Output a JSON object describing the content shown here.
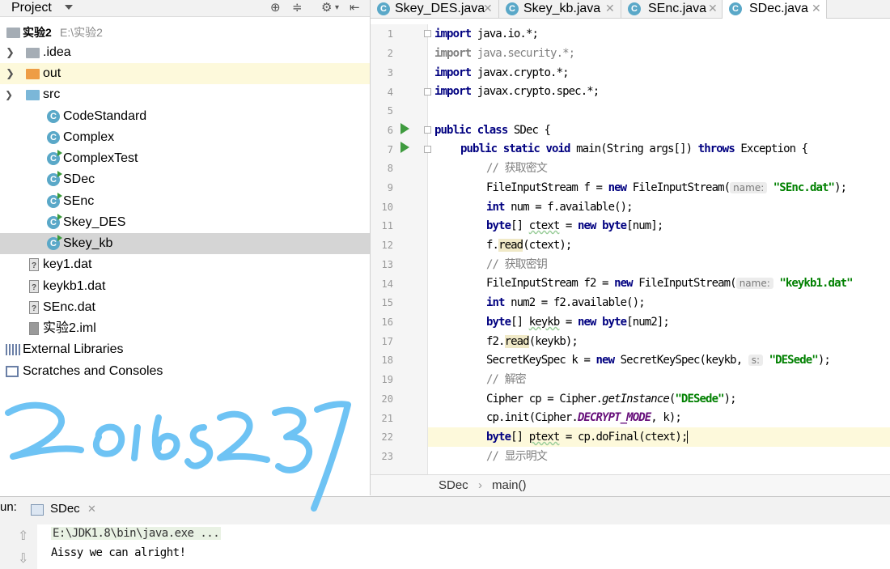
{
  "project_panel": {
    "title": "Project",
    "tree": [
      {
        "label": "实验2",
        "path": "E:\\实验2",
        "type": "module"
      },
      {
        "label": ".idea",
        "type": "folder"
      },
      {
        "label": "out",
        "type": "folder"
      },
      {
        "label": "src",
        "type": "folder"
      },
      {
        "label": "CodeStandard",
        "type": "class"
      },
      {
        "label": "Complex",
        "type": "class"
      },
      {
        "label": "ComplexTest",
        "type": "class"
      },
      {
        "label": "SDec",
        "type": "class"
      },
      {
        "label": "SEnc",
        "type": "class"
      },
      {
        "label": "Skey_DES",
        "type": "class"
      },
      {
        "label": "Skey_kb",
        "type": "class"
      },
      {
        "label": "key1.dat",
        "type": "file"
      },
      {
        "label": "keykb1.dat",
        "type": "file"
      },
      {
        "label": "SEnc.dat",
        "type": "file"
      },
      {
        "label": "实验2.iml",
        "type": "file"
      },
      {
        "label": "External Libraries",
        "type": "library"
      },
      {
        "label": "Scratches and Consoles",
        "type": "scratches"
      }
    ]
  },
  "editor": {
    "tabs": [
      {
        "label": "Skey_DES.java"
      },
      {
        "label": "Skey_kb.java"
      },
      {
        "label": "SEnc.java"
      },
      {
        "label": "SDec.java",
        "active": true
      }
    ],
    "line_numbers": [
      "1",
      "2",
      "3",
      "4",
      "5",
      "6",
      "7",
      "8",
      "9",
      "10",
      "11",
      "12",
      "13",
      "14",
      "15",
      "16",
      "17",
      "18",
      "19",
      "20",
      "21",
      "22",
      "23"
    ],
    "code": {
      "l1_kw": "import",
      "l1_rest": " java.io.*;",
      "l2_kw": "import",
      "l2_rest": " java.security.*;",
      "l3_kw": "import",
      "l3_rest": " javax.crypto.*;",
      "l4_kw": "import",
      "l4_rest": " javax.crypto.spec.*;",
      "l6_kw1": "public",
      "l6_kw2": "class",
      "l6_rest": " SDec {",
      "l7_kw1": "public",
      "l7_kw2": "static",
      "l7_kw3": "void",
      "l7_mid": " main(String args[]) ",
      "l7_kw4": "throws",
      "l7_rest": " Exception {",
      "l8": "// 获取密文",
      "l9_a": "FileInputStream f = ",
      "l9_kw": "new",
      "l9_b": " FileInputStream(",
      "l9_hint": "name:",
      "l9_str": "\"SEnc.dat\"",
      "l9_end": ");",
      "l10_kw": "int",
      "l10_rest": " num = f.available();",
      "l11_kw1": "byte",
      "l11_a": "[] ",
      "l11_var": "ctext",
      "l11_b": " = ",
      "l11_kw2": "new",
      "l11_kw3": "byte",
      "l11_c": "[num];",
      "l12_a": "f.",
      "l12_m": "read",
      "l12_b": "(ctext);",
      "l13": "// 获取密钥",
      "l14_a": "FileInputStream f2 = ",
      "l14_kw": "new",
      "l14_b": " FileInputStream(",
      "l14_hint": "name:",
      "l14_str": "\"keykb1.dat\"",
      "l15_kw": "int",
      "l15_rest": " num2 = f2.available();",
      "l16_kw1": "byte",
      "l16_a": "[] ",
      "l16_var": "keykb",
      "l16_b": " = ",
      "l16_kw2": "new",
      "l16_kw3": "byte",
      "l16_c": "[num2];",
      "l17_a": "f2.",
      "l17_m": "read",
      "l17_b": "(keykb);",
      "l18_a": "SecretKeySpec k = ",
      "l18_kw": "new",
      "l18_b": " SecretKeySpec(keykb, ",
      "l18_hint": "s:",
      "l18_str": "\"DESede\"",
      "l18_end": ");",
      "l19": "// 解密",
      "l20_a": "Cipher cp = Cipher.",
      "l20_m": "getInstance",
      "l20_b": "(",
      "l20_str": "\"DESede\"",
      "l20_end": ");",
      "l21_a": "cp.init(Cipher.",
      "l21_const": "DECRYPT_MODE",
      "l21_b": ", k);",
      "l22_kw": "byte",
      "l22_a": "[] ",
      "l22_var": "ptext",
      "l22_b": " = cp.doFinal(ctext);",
      "l23": "// 显示明文"
    },
    "breadcrumb": [
      "SDec",
      "main()"
    ]
  },
  "run_panel": {
    "label": "un:",
    "tab": "SDec",
    "console": [
      "E:\\JDK1.8\\bin\\java.exe ...",
      "Aissy we can alright!"
    ]
  },
  "overlay": {
    "handwriting": "20165237",
    "color": "#6ec3f4"
  }
}
